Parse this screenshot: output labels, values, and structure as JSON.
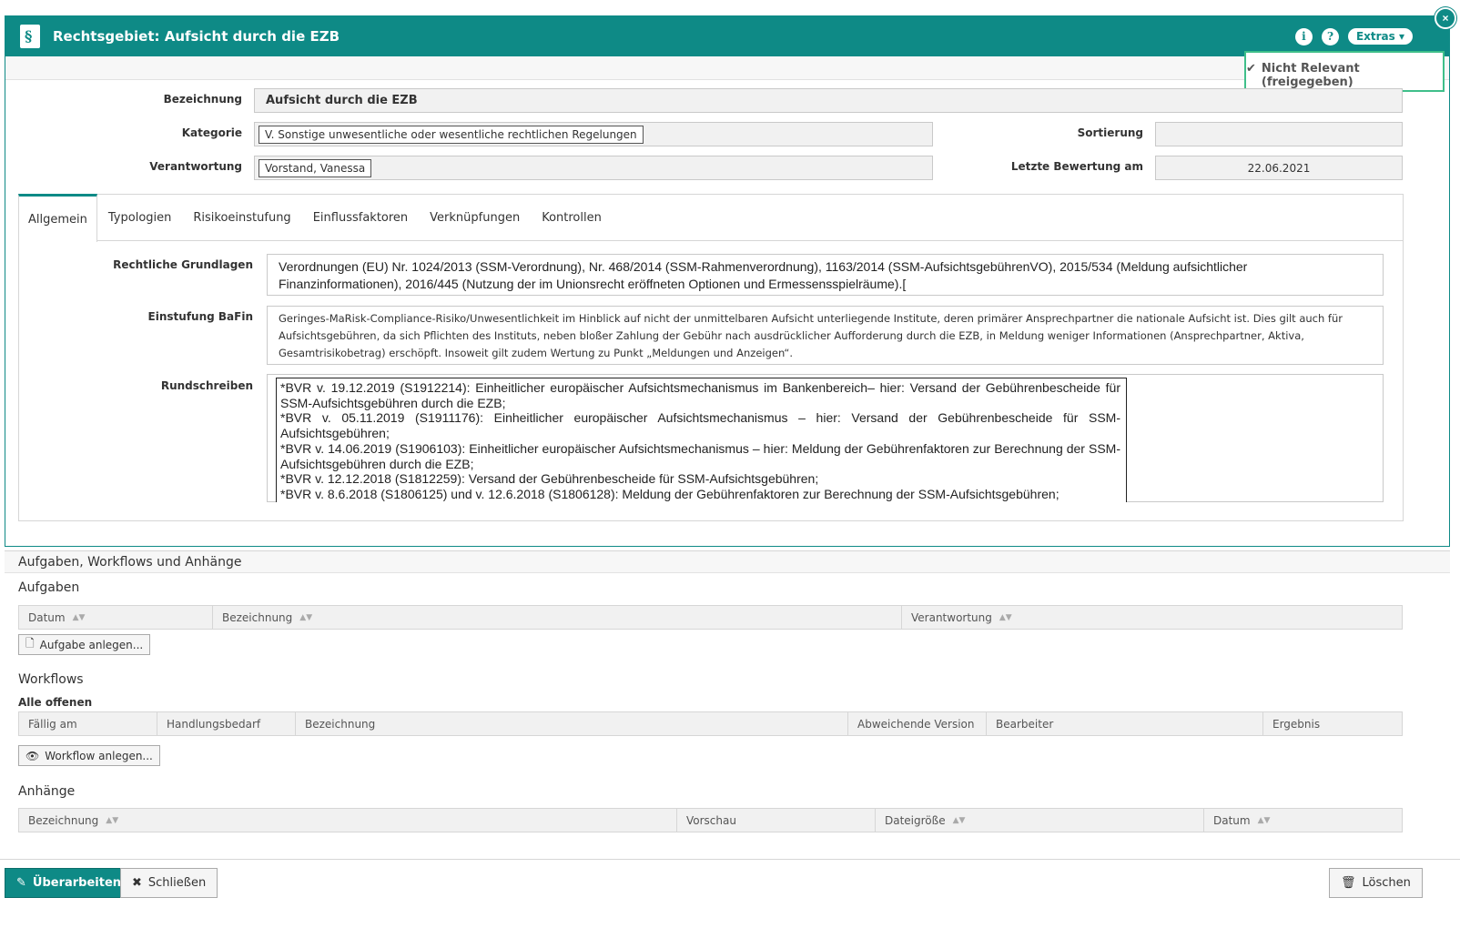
{
  "window": {
    "title": "Rechtsgebiet: Aufsicht durch die EZB",
    "info_icon": "i",
    "help_icon": "?",
    "extras_label": "Extras ▾",
    "close_label": "×"
  },
  "status": {
    "label": "Nicht Relevant (freigegeben)",
    "accent": "#3fbf8a"
  },
  "form": {
    "bezeichnung_label": "Bezeichnung",
    "bezeichnung_value": "Aufsicht durch die EZB",
    "kategorie_label": "Kategorie",
    "kategorie_value": "V. Sonstige unwesentliche oder wesentliche rechtlichen Regelungen",
    "verantwortung_label": "Verantwortung",
    "verantwortung_value": "Vorstand, Vanessa",
    "sortierung_label": "Sortierung",
    "sortierung_value": "",
    "letzte_bewertung_label": "Letzte Bewertung am",
    "letzte_bewertung_value": "22.06.2021"
  },
  "tabs": [
    "Allgemein",
    "Typologien",
    "Risikoeinstufung",
    "Einflussfaktoren",
    "Verknüpfungen",
    "Kontrollen"
  ],
  "general": {
    "rechtliche_grundlagen_label": "Rechtliche Grundlagen",
    "rechtliche_grundlagen_value": "Verordnungen (EU) Nr. 1024/2013 (SSM-Verordnung), Nr. 468/2014 (SSM-Rahmenverordnung), 1163/2014 (SSM-AufsichtsgebührenVO), 2015/534 (Meldung aufsichtlicher Finanzinformationen), 2016/445 (Nutzung der im Unionsrecht eröffneten Optionen und Ermessensspielräume).[",
    "einstufung_label": "Einstufung BaFin",
    "einstufung_value": "Geringes-MaRisk-Compliance-Risiko/Unwesentlichkeit im Hinblick auf nicht der unmittelbaren Aufsicht unterliegende Institute, deren primärer Ansprechpartner die nationale Aufsicht ist. Dies gilt auch für Aufsichtsgebühren, da sich Pflichten des Instituts, neben bloßer Zahlung der Gebühr nach ausdrücklicher Aufforderung durch die EZB, in Meldung weniger Informationen (Ansprechpartner, Aktiva, Gesamtrisikobetrag) erschöpft. Insoweit gilt zudem Wertung zu Punkt „Meldungen und Anzeigen“.",
    "rundschreiben_label": "Rundschreiben",
    "rundschreiben_lines": [
      "*BVR v. 19.12.2019 (S1912214): Einheitlicher europäischer Aufsichtsmechanismus im Bankenbereich– hier: Versand der Gebührenbescheide für SSM-Aufsichtsgebühren durch die EZB;",
      "*BVR v. 05.11.2019 (S1911176): Einheitlicher europäischer Aufsichtsmechanismus – hier: Versand der Gebührenbescheide für SSM-Aufsichtsgebühren;",
      "*BVR v. 14.06.2019 (S1906103): Einheitlicher europäischer Aufsichtsmechanismus – hier: Meldung der Gebührenfaktoren zur Berechnung der SSM-Aufsichtsgebühren durch die EZB;",
      "*BVR v. 12.12.2018 (S1812259): Versand der Gebührenbescheide für SSM-Aufsichtsgebühren;",
      "*BVR v. 8.6.2018 (S1806125) und v. 12.6.2018 (S1806128): Meldung der Gebührenfaktoren zur Berechnung der SSM-Aufsichtsgebühren;"
    ]
  },
  "lower": {
    "section_title": "Aufgaben, Workflows und Anhänge",
    "aufgaben": {
      "title": "Aufgaben",
      "columns": [
        "Datum",
        "Bezeichnung",
        "Verantwortung"
      ],
      "add_label": "Aufgabe anlegen..."
    },
    "workflows": {
      "title": "Workflows",
      "filter": "Alle offenen",
      "columns": [
        "Fällig am",
        "Handlungsbedarf",
        "Bezeichnung",
        "Abweichende Version",
        "Bearbeiter",
        "Ergebnis"
      ],
      "add_label": "Workflow anlegen..."
    },
    "anhaenge": {
      "title": "Anhänge",
      "columns": [
        "Bezeichnung",
        "Vorschau",
        "Dateigröße",
        "Datum"
      ]
    }
  },
  "footer": {
    "edit_label": "Überarbeiten",
    "close_label": "Schließen",
    "delete_label": "Löschen"
  },
  "colors": {
    "brand": "#0e8a86"
  }
}
